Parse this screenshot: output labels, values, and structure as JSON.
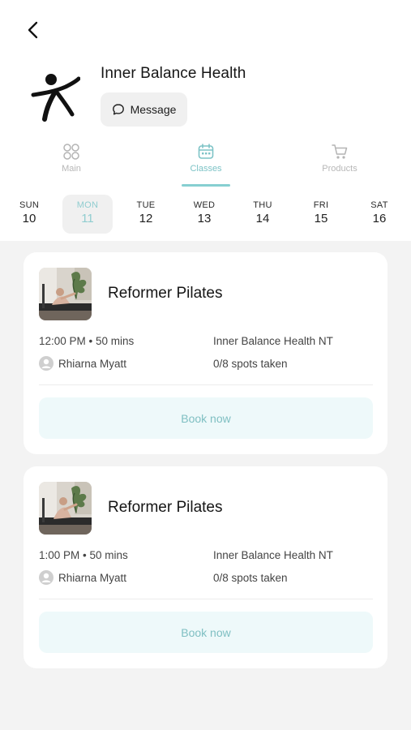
{
  "header": {
    "brand_name": "Inner Balance Health",
    "message_label": "Message"
  },
  "tabs": [
    {
      "label": "Main",
      "icon": "grid-icon",
      "active": false
    },
    {
      "label": "Classes",
      "icon": "calendar-icon",
      "active": true
    },
    {
      "label": "Products",
      "icon": "cart-icon",
      "active": false
    }
  ],
  "days": [
    {
      "name": "SUN",
      "num": "10"
    },
    {
      "name": "MON",
      "num": "11",
      "selected": true
    },
    {
      "name": "TUE",
      "num": "12"
    },
    {
      "name": "WED",
      "num": "13"
    },
    {
      "name": "THU",
      "num": "14"
    },
    {
      "name": "FRI",
      "num": "15"
    },
    {
      "name": "SAT",
      "num": "16"
    }
  ],
  "classes": [
    {
      "title": "Reformer Pilates",
      "time": "12:00 PM • 50 mins",
      "location": "Inner Balance Health NT",
      "instructor": "Rhiarna Myatt",
      "spots": "0/8 spots taken",
      "book_label": "Book now"
    },
    {
      "title": "Reformer Pilates",
      "time": "1:00 PM • 50 mins",
      "location": "Inner Balance Health NT",
      "instructor": "Rhiarna Myatt",
      "spots": "0/8 spots taken",
      "book_label": "Book now"
    }
  ],
  "colors": {
    "accent": "#86cfd1",
    "accent_text": "#7fbfc2",
    "book_bg": "#eef9fa",
    "page_bg": "#f3f3f3"
  }
}
